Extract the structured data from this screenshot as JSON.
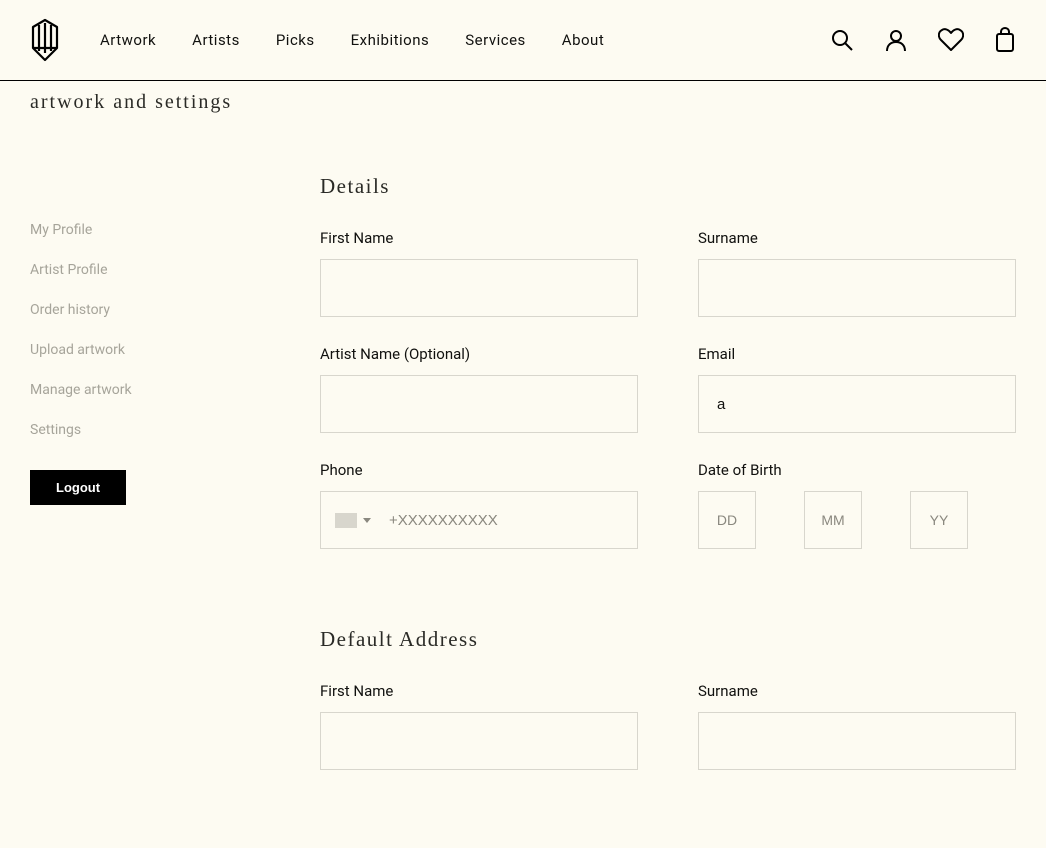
{
  "nav": [
    "Artwork",
    "Artists",
    "Picks",
    "Exhibitions",
    "Services",
    "About"
  ],
  "breadcrumb": "artwork and settings",
  "sidebar": {
    "items": [
      "My Profile",
      "Artist Profile",
      "Order history",
      "Upload artwork",
      "Manage artwork",
      "Settings"
    ],
    "logout": "Logout"
  },
  "sections": {
    "details": {
      "title": "Details",
      "fields": {
        "first_name": {
          "label": "First Name",
          "value": ""
        },
        "surname": {
          "label": "Surname",
          "value": ""
        },
        "artist_name": {
          "label": "Artist Name (Optional)",
          "value": ""
        },
        "email": {
          "label": "Email",
          "value": "a"
        },
        "phone": {
          "label": "Phone",
          "placeholder": "+XXXXXXXXXX",
          "value": ""
        },
        "dob": {
          "label": "Date of Birth",
          "dd": {
            "placeholder": "DD",
            "value": ""
          },
          "mm": {
            "placeholder": "MM",
            "value": ""
          },
          "yy": {
            "placeholder": "YY",
            "value": ""
          }
        }
      }
    },
    "address": {
      "title": "Default Address",
      "fields": {
        "first_name": {
          "label": "First Name",
          "value": ""
        },
        "surname": {
          "label": "Surname",
          "value": ""
        }
      }
    }
  }
}
